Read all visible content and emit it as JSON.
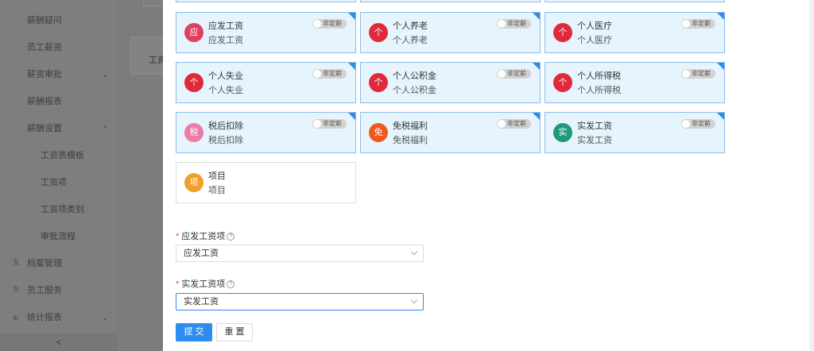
{
  "sidebar": {
    "items": [
      {
        "label": "薪酬疑问"
      },
      {
        "label": "员工薪资"
      },
      {
        "label": "薪资审批",
        "arrow": "⌄"
      },
      {
        "label": "薪酬报表"
      },
      {
        "label": "薪酬设置",
        "arrow": "⌃"
      },
      {
        "label": "工资表模板"
      },
      {
        "label": "工资项"
      },
      {
        "label": "工资项类别"
      },
      {
        "label": "审批流程"
      },
      {
        "label": "档案管理",
        "icon": "ℛ"
      },
      {
        "label": "员工服务",
        "icon": "ℛ"
      },
      {
        "label": "统计报表",
        "icon": "ılı",
        "arrow": "⌄"
      }
    ],
    "collapse": "<"
  },
  "background": {
    "card_label": "工资"
  },
  "tiles": [
    {
      "badge": "应",
      "color": "#e0405f",
      "name": "应发工资",
      "sub": "应发工资",
      "toggle": "非定薪",
      "corner": true
    },
    {
      "badge": "个",
      "color": "#e02a3c",
      "name": "个人养老",
      "sub": "个人养老",
      "toggle": "非定薪",
      "corner": true
    },
    {
      "badge": "个",
      "color": "#e02a3c",
      "name": "个人医疗",
      "sub": "个人医疗",
      "toggle": "非定薪",
      "corner": true
    },
    {
      "badge": "个",
      "color": "#e02a3c",
      "name": "个人失业",
      "sub": "个人失业",
      "toggle": "非定薪",
      "corner": true
    },
    {
      "badge": "个",
      "color": "#e02a3c",
      "name": "个人公积金",
      "sub": "个人公积金",
      "toggle": "非定薪",
      "corner": true
    },
    {
      "badge": "个",
      "color": "#e02a3c",
      "name": "个人所得税",
      "sub": "个人所得税",
      "toggle": "非定薪",
      "corner": true
    },
    {
      "badge": "税",
      "color": "#ee7aa6",
      "name": "税后扣除",
      "sub": "税后扣除",
      "toggle": "非定薪",
      "corner": true
    },
    {
      "badge": "免",
      "color": "#ee5a1c",
      "name": "免税福利",
      "sub": "免税福利",
      "toggle": "非定薪",
      "corner": true
    },
    {
      "badge": "实",
      "color": "#1f9a78",
      "name": "实发工资",
      "sub": "实发工资",
      "toggle": "非定薪",
      "corner": true
    },
    {
      "badge": "项",
      "color": "#f0a028",
      "name": "项目",
      "sub": "项目",
      "plain": true
    }
  ],
  "form": {
    "gross_label": "应发工资项",
    "gross_value": "应发工资",
    "net_label": "实发工资项",
    "net_value": "实发工资",
    "required_mark": "*",
    "help_glyph": "?"
  },
  "actions": {
    "submit": "提 交",
    "reset": "重 置"
  }
}
